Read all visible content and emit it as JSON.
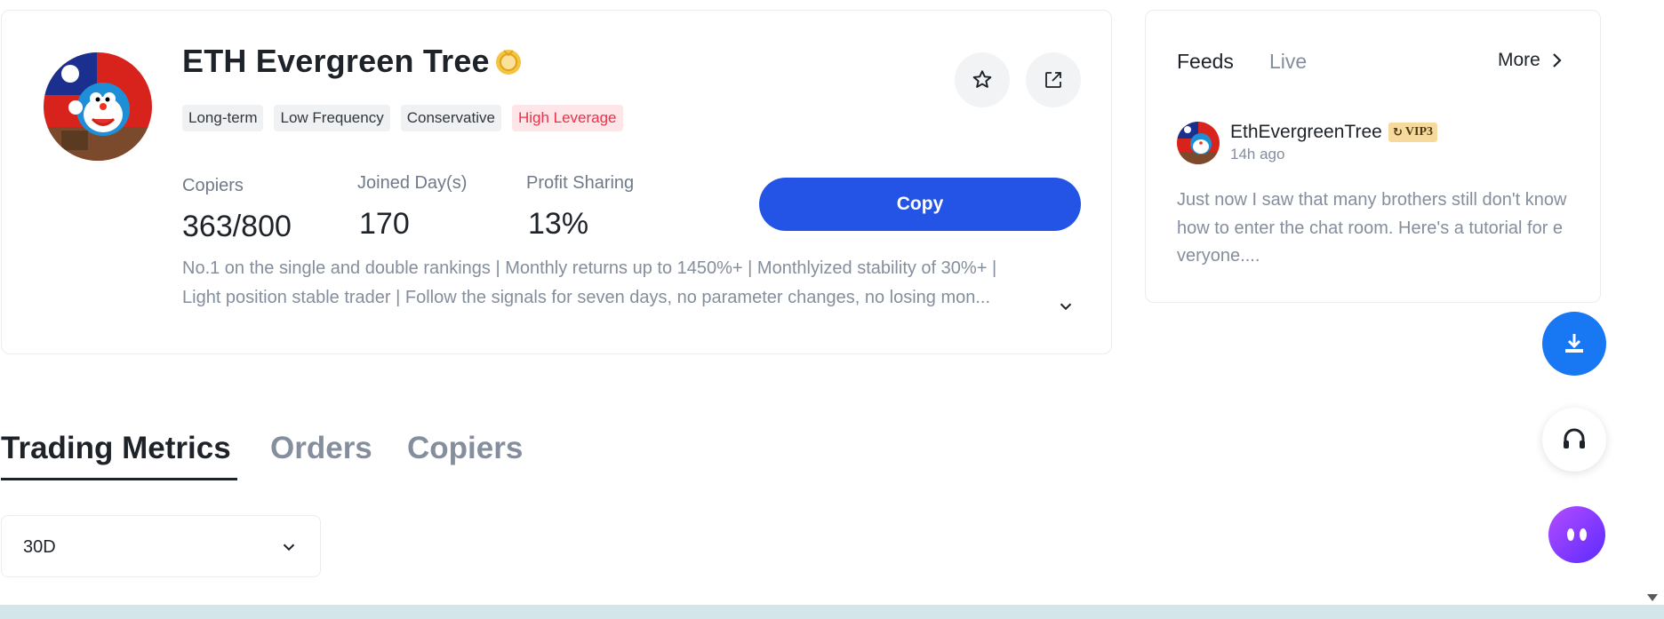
{
  "trader": {
    "name": "ETH Evergreen Tree",
    "tags": [
      "Long-term",
      "Low Frequency",
      "Conservative",
      "High Leverage"
    ],
    "stats": {
      "copiers_label": "Copiers",
      "copiers_value": "363/800",
      "joined_label": "Joined Day(s)",
      "joined_value": "170",
      "profit_label": "Profit Sharing",
      "profit_value": "13%"
    },
    "copy_label": "Copy",
    "description": [
      "No.1 on the single and double rankings | Monthly returns up to 1450%+ | Monthlyized stability of 30%+ |",
      "Light position stable trader | Follow the signals for seven days, no parameter changes, no losing mon..."
    ]
  },
  "feed": {
    "tabs": [
      "Feeds",
      "Live"
    ],
    "more_label": "More",
    "post": {
      "user": "EthEvergreenTree",
      "vip": "VIP3",
      "time": "14h ago",
      "text": "Just now I saw that many brothers still don't know how to enter the chat room. Here's a tutorial for everyone...."
    }
  },
  "tabs": [
    "Trading Metrics",
    "Orders",
    "Copiers"
  ],
  "period": {
    "value": "30D"
  },
  "colors": {
    "primary": "#2354e6",
    "danger": "#e8334a",
    "text": "#1e2329",
    "muted": "#848e9c",
    "gold": "#f0b90b"
  },
  "icons": {
    "favorite": "star-icon",
    "share": "share-icon",
    "download": "download-icon",
    "support": "headset-icon",
    "assistant": "chat-bot-icon"
  }
}
